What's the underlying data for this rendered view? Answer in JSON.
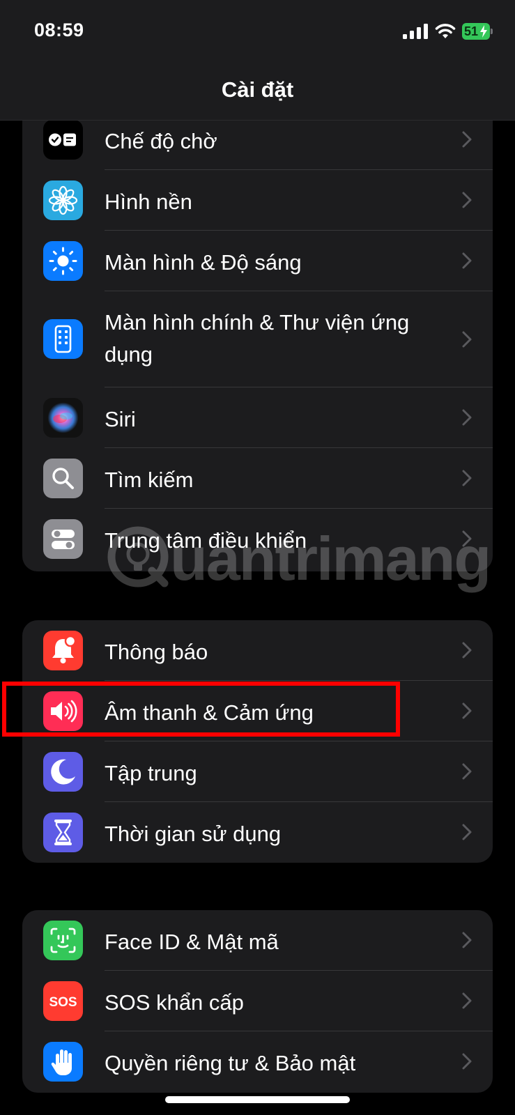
{
  "status_bar": {
    "time": "08:59",
    "battery_level": "51",
    "icons": [
      "cellular-signal-icon",
      "wifi-icon",
      "battery-charging-icon"
    ]
  },
  "header": {
    "title": "Cài đặt"
  },
  "groups": [
    {
      "items": [
        {
          "label": "Chế độ chờ",
          "icon": "standby-icon",
          "icon_color": "#000000"
        },
        {
          "label": "Hình nền",
          "icon": "wallpaper-flower-icon",
          "icon_color": "#2aa9e0"
        },
        {
          "label": "Màn hình & Độ sáng",
          "icon": "brightness-sun-icon",
          "icon_color": "#0a7bff"
        },
        {
          "label": "Màn hình chính & Thư viện ứng dụng",
          "icon": "home-screen-icon",
          "icon_color": "#0a7bff"
        },
        {
          "label": "Siri",
          "icon": "siri-icon",
          "icon_color": "#1a1a1a"
        },
        {
          "label": "Tìm kiếm",
          "icon": "search-icon",
          "icon_color": "#8e8e93"
        },
        {
          "label": "Trung tâm điều khiển",
          "icon": "control-center-icon",
          "icon_color": "#8e8e93"
        }
      ]
    },
    {
      "items": [
        {
          "label": "Thông báo",
          "icon": "notification-bell-icon",
          "icon_color": "#ff3b30"
        },
        {
          "label": "Âm thanh & Cảm ứng",
          "icon": "speaker-icon",
          "icon_color": "#ff2d55"
        },
        {
          "label": "Tập trung",
          "icon": "moon-icon",
          "icon_color": "#5e5ce6"
        },
        {
          "label": "Thời gian sử dụng",
          "icon": "hourglass-icon",
          "icon_color": "#5e5ce6"
        }
      ]
    },
    {
      "items": [
        {
          "label": "Face ID & Mật mã",
          "icon": "face-id-icon",
          "icon_color": "#34c759"
        },
        {
          "label": "SOS khẩn cấp",
          "icon": "sos-icon",
          "icon_color": "#ff3b30",
          "icon_text": "SOS"
        },
        {
          "label": "Quyền riêng tư & Bảo mật",
          "icon": "hand-icon",
          "icon_color": "#0a7bff"
        }
      ]
    }
  ],
  "highlight": {
    "target": "Âm thanh & Cảm ứng",
    "color": "#ff0000"
  },
  "watermark": {
    "text": "uantrimang"
  },
  "colors": {
    "background": "#000000",
    "group_background": "#1c1c1e",
    "separator": "#38383a",
    "chevron": "#5a5a5e",
    "text": "#ffffff"
  }
}
